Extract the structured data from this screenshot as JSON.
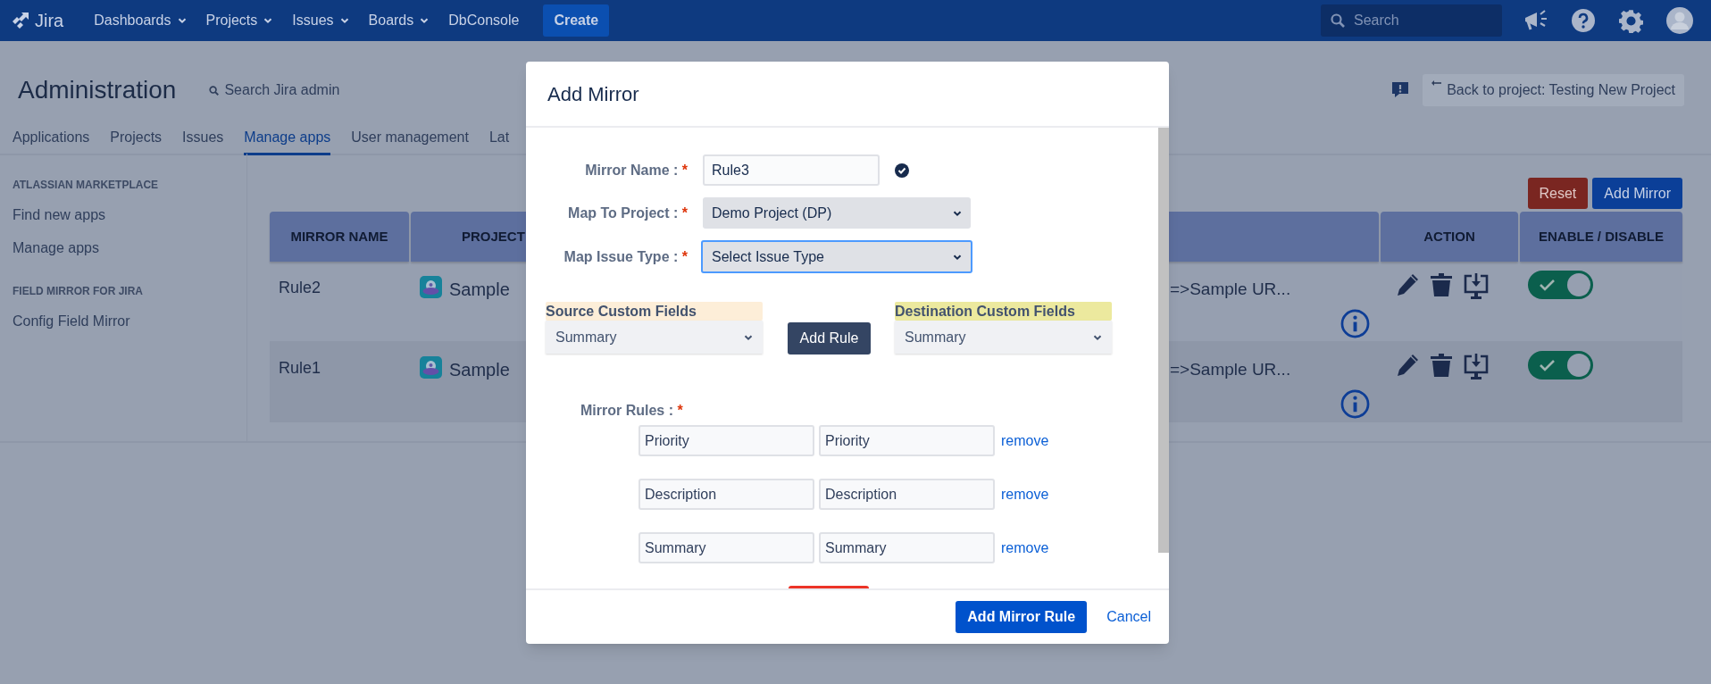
{
  "top_nav": {
    "logo": "Jira",
    "items": [
      {
        "label": "Dashboards",
        "dropdown": true
      },
      {
        "label": "Projects",
        "dropdown": true
      },
      {
        "label": "Issues",
        "dropdown": true
      },
      {
        "label": "Boards",
        "dropdown": true
      },
      {
        "label": "DbConsole",
        "dropdown": false
      }
    ],
    "create": "Create",
    "search": {
      "placeholder": "Search"
    }
  },
  "header": {
    "title": "Administration",
    "search_link": "Search Jira admin",
    "back_button": "Back to project: Testing New Project"
  },
  "tabs": [
    {
      "label": "Applications",
      "selected": false
    },
    {
      "label": "Projects",
      "selected": false
    },
    {
      "label": "Issues",
      "selected": false
    },
    {
      "label": "Manage apps",
      "selected": true
    },
    {
      "label": "User management",
      "selected": false
    },
    {
      "label": "Lat",
      "selected": false
    }
  ],
  "sidebar": {
    "sections": [
      {
        "heading": "ATLASSIAN MARKETPLACE",
        "items": [
          "Find new apps",
          "Manage apps"
        ]
      },
      {
        "heading": "FIELD MIRROR FOR JIRA",
        "items": [
          "Config Field Mirror"
        ]
      }
    ]
  },
  "toolbar": [
    {
      "label": "Reset",
      "kind": "danger"
    },
    {
      "label": "Add Mirror",
      "kind": "primary"
    }
  ],
  "table": {
    "columns": [
      "MIRROR NAME",
      "PROJECT",
      "",
      "ACTION",
      "ENABLE / DISABLE"
    ],
    "rows": [
      {
        "mirror_name": "Rule2",
        "project": "Sample",
        "mapping": "=>Sample UR...",
        "enabled": true
      },
      {
        "mirror_name": "Rule1",
        "project": "Sample",
        "mapping": "=>Sample UR...",
        "enabled": true
      }
    ]
  },
  "modal": {
    "title": "Add Mirror",
    "fields": [
      {
        "label": "Mirror Name :",
        "required_mark": "*",
        "kind": "text",
        "value": "Rule3",
        "valid": true,
        "focused": false
      },
      {
        "label": "Map To Project :",
        "required_mark": "*",
        "kind": "select",
        "value": "Demo Project (DP)",
        "focused": false
      },
      {
        "label": "Map Issue Type :",
        "required_mark": "*",
        "kind": "select",
        "value": "Select Issue Type",
        "focused": true
      }
    ],
    "source": {
      "label": "Source Custom Fields",
      "value": "Summary"
    },
    "add_rule": "Add Rule",
    "destination": {
      "label": "Destination Custom Fields",
      "value": "Summary"
    },
    "rules_label": "Mirror Rules :",
    "rules_required_mark": "*",
    "rules": [
      {
        "source": "Priority",
        "destination": "Priority",
        "remove": "remove"
      },
      {
        "source": "Description",
        "destination": "Description",
        "remove": "remove"
      },
      {
        "source": "Summary",
        "destination": "Summary",
        "remove": "remove"
      }
    ],
    "footer": {
      "submit": "Add Mirror Rule",
      "cancel": "Cancel"
    }
  }
}
